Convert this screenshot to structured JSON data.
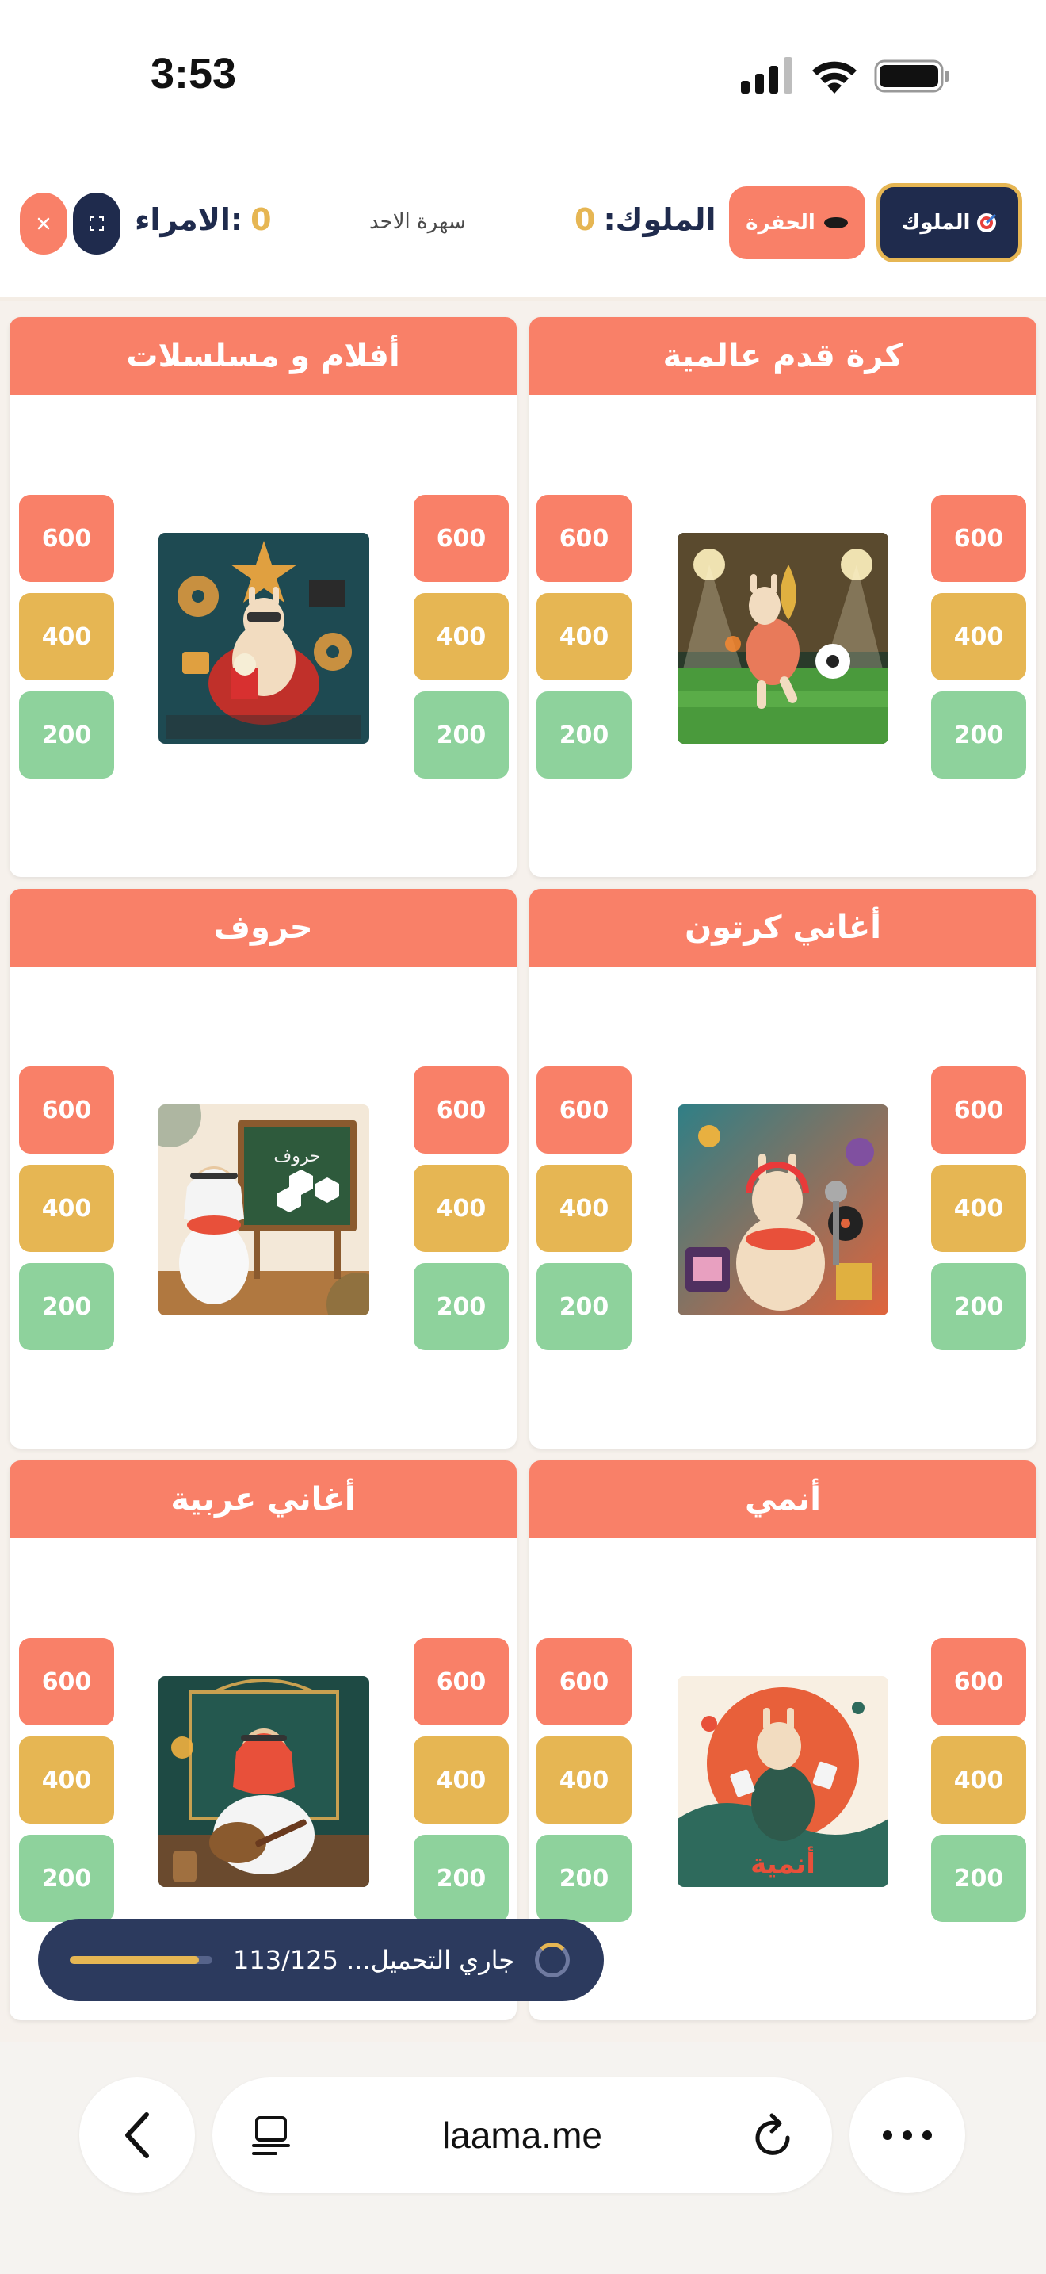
{
  "status": {
    "time": "3:53"
  },
  "header": {
    "kings_button": "الملوك",
    "pit_button": "الحفرة",
    "kings_label": "الملوك:",
    "kings_score": "0",
    "session_name": "سهرة الاحد",
    "princes_label": ":الامراء",
    "princes_score": "0",
    "icons": {
      "kings": "target-icon",
      "pit": "hole-icon",
      "fullscreen": "fullscreen-icon",
      "close": "close-icon"
    }
  },
  "categories": [
    {
      "title": "كرة قدم عالمية",
      "image": "football-llama"
    },
    {
      "title": "أفلام و مسلسلات",
      "image": "movies-llama"
    },
    {
      "title": "أغاني كرتون",
      "image": "cartoon-songs-llama"
    },
    {
      "title": "حروف",
      "image": "letters-llama",
      "image_text": "حروف"
    },
    {
      "title": "أنمي",
      "image": "anime-llama",
      "image_text": "أنمية"
    },
    {
      "title": "أغاني عربية",
      "image": "arabic-songs-llama"
    }
  ],
  "points": {
    "high": "600",
    "mid": "400",
    "low": "200"
  },
  "colors": {
    "coral": "#f98068",
    "gold": "#e6b653",
    "green": "#8ed29c",
    "navy": "#1f2b4d"
  },
  "loading": {
    "text": "جاري التحميل... 113/125",
    "loaded": 113,
    "total": 125
  },
  "browser": {
    "url": "laama.me"
  }
}
